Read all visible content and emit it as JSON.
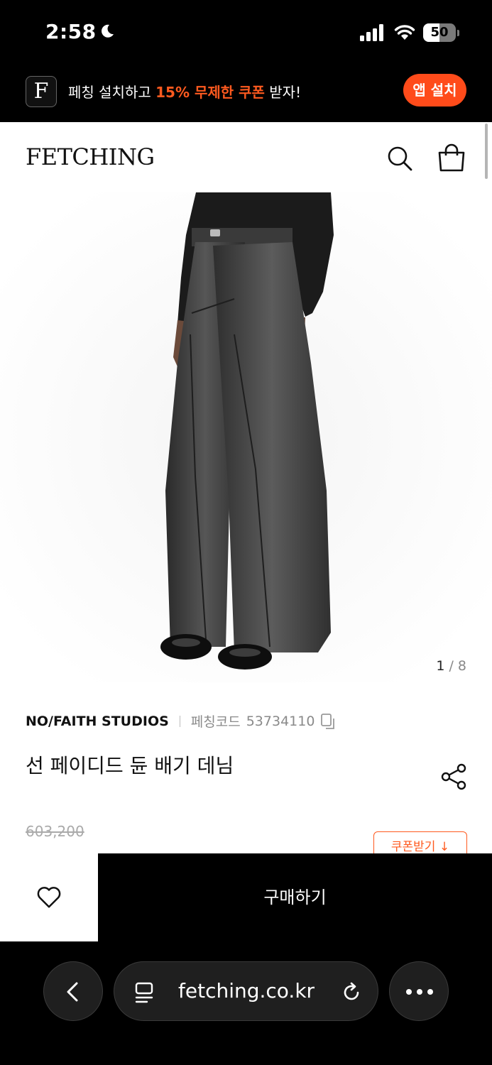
{
  "status_bar": {
    "time": "2:58",
    "battery": "50",
    "battery_level": 0.5
  },
  "app_banner": {
    "logo_letter": "F",
    "text_before": "페칭 설치하고 ",
    "text_highlight": "15% 무제한 쿠폰",
    "text_after": " 받자!",
    "install_label": "앱 설치",
    "accent_color": "#ff4b1a"
  },
  "header": {
    "logo": "FETCHING"
  },
  "gallery": {
    "current": "1",
    "separator": "/",
    "total": "8"
  },
  "product": {
    "brand": "NO/FAITH STUDIOS",
    "code_label": "페칭코드",
    "code_value": "53734110",
    "name": "선 페이디드 듄 배기 데님",
    "original_price": "603,200",
    "coupon_label": "쿠폰받기 ↓"
  },
  "bottom_bar": {
    "buy_label": "구매하기"
  },
  "browser": {
    "url": "fetching.co.kr"
  }
}
